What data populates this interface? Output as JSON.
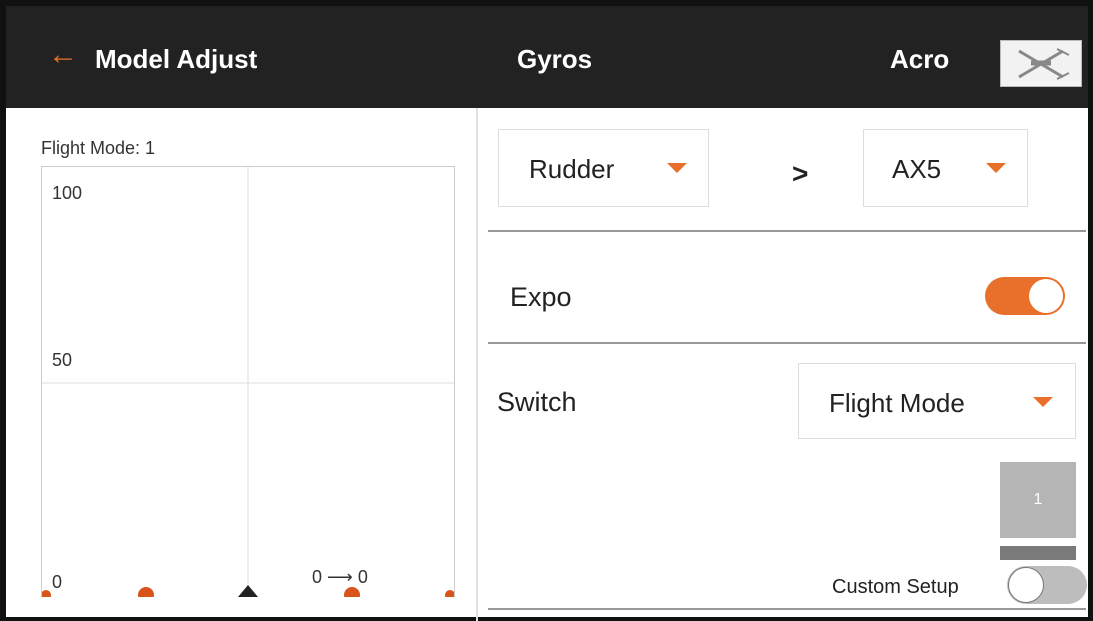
{
  "header": {
    "back_label": "Model Adjust",
    "center_title": "Gyros",
    "mode_label": "Acro",
    "icons": {
      "back": "arrow-left-icon",
      "model": "airplane-icon"
    }
  },
  "graph": {
    "flight_mode_label": "Flight Mode: 1",
    "y_labels": [
      "100",
      "50",
      "0"
    ],
    "arrow_label": "0 ⟶ 0"
  },
  "controls": {
    "source_select": "Rudder",
    "comparator": ">",
    "channel_select": "AX5",
    "expo_label": "Expo",
    "expo_on": true,
    "switch_label": "Switch",
    "switch_select": "Flight Mode",
    "flight_mode_index": "1",
    "custom_setup_label": "Custom Setup",
    "custom_setup_on": false
  },
  "colors": {
    "accent": "#e8702a",
    "header_bg": "#222222"
  }
}
